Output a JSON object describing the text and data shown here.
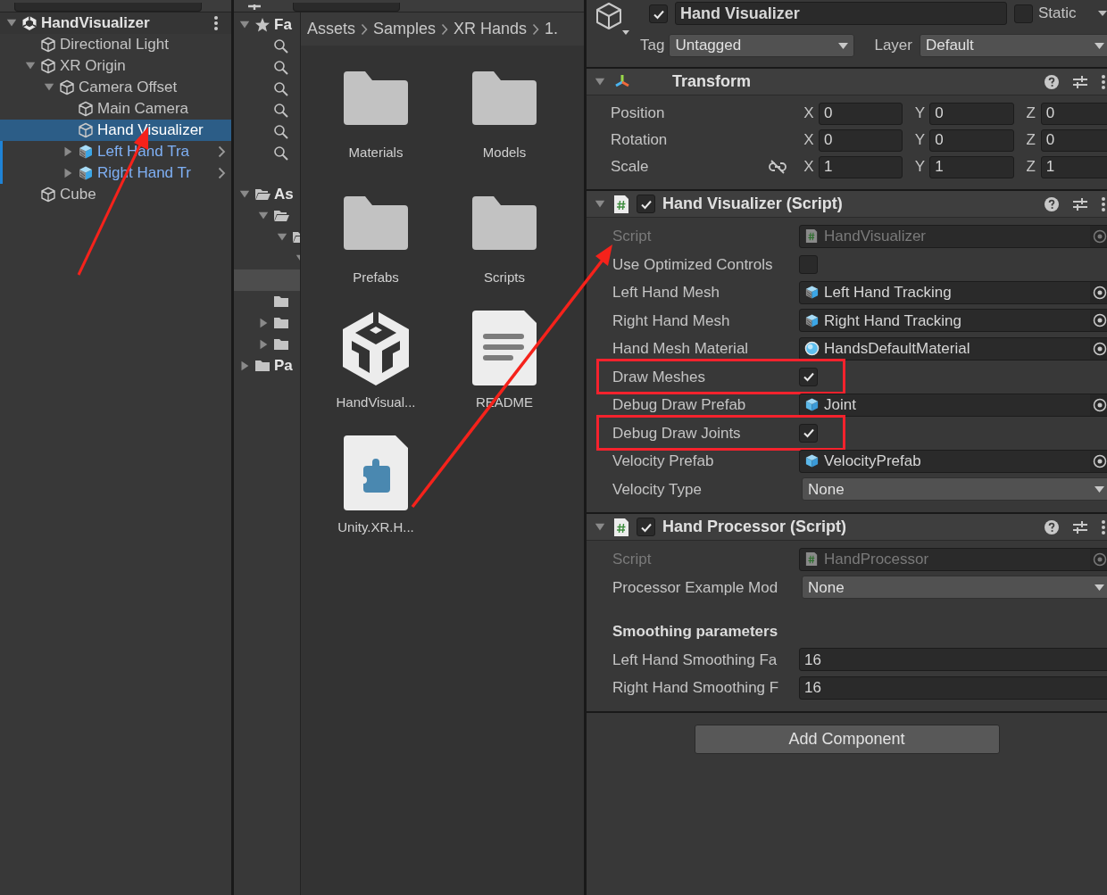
{
  "hierarchy": {
    "scene": {
      "label": "HandVisualizer",
      "kind": "scene",
      "expanded": true,
      "children": [
        {
          "label": "Directional Light",
          "kind": "gameobject",
          "selected": false
        },
        {
          "label": "XR Origin",
          "kind": "gameobject",
          "expanded": true,
          "selected": false,
          "children": [
            {
              "label": "Camera Offset",
              "kind": "gameobject",
              "expanded": true,
              "selected": false,
              "children": [
                {
                  "label": "Main Camera",
                  "kind": "gameobject",
                  "selected": false
                },
                {
                  "label": "Hand Visualizer",
                  "kind": "gameobject",
                  "selected": true
                },
                {
                  "label": "Left Hand Tra",
                  "kind": "prefab",
                  "expanded": false,
                  "selected": false
                },
                {
                  "label": "Right Hand Tr",
                  "kind": "prefab",
                  "expanded": false,
                  "selected": false
                }
              ]
            }
          ]
        },
        {
          "label": "Cube",
          "kind": "gameobject",
          "selected": false
        }
      ]
    }
  },
  "project": {
    "tree": [
      {
        "label": "Fa",
        "kind": "favorites",
        "expanded": true,
        "selected": false,
        "children": [
          {
            "kind": "search",
            "selected": false
          },
          {
            "kind": "search",
            "selected": false
          },
          {
            "kind": "search",
            "selected": false
          },
          {
            "kind": "search",
            "selected": false
          },
          {
            "kind": "search",
            "selected": false
          },
          {
            "kind": "search",
            "selected": false
          }
        ]
      },
      {
        "label": "As",
        "kind": "folder-open",
        "expanded": true,
        "selected": false,
        "children": [
          {
            "kind": "folder-open",
            "expanded": true,
            "selected": false,
            "children": [
              {
                "kind": "folder-open",
                "expanded": true,
                "selected": false,
                "children": [
                  {
                    "expanded": true,
                    "selected": false,
                    "children": [
                      {
                        "selected": true
                      }
                    ]
                  }
                ]
              }
            ]
          },
          {
            "kind": "folder",
            "selected": false
          },
          {
            "kind": "folder",
            "expanded": false,
            "selected": false
          },
          {
            "kind": "folder",
            "expanded": false,
            "selected": false
          }
        ]
      },
      {
        "label": "Pa",
        "kind": "folder",
        "expanded": false,
        "selected": false
      }
    ],
    "breadcrumb": [
      "Assets",
      "Samples",
      "XR Hands",
      "1."
    ],
    "assets": [
      {
        "label": "Materials",
        "kind": "folder"
      },
      {
        "label": "Models",
        "kind": "folder"
      },
      {
        "label": "Prefabs",
        "kind": "folder"
      },
      {
        "label": "Scripts",
        "kind": "folder"
      },
      {
        "label": "HandVisual...",
        "kind": "unity"
      },
      {
        "label": "README",
        "kind": "document"
      },
      {
        "label": "Unity.XR.H...",
        "kind": "package"
      }
    ]
  },
  "inspector": {
    "active": true,
    "name": "Hand Visualizer",
    "static": false,
    "static_label": "Static",
    "tag_label": "Tag",
    "tag": "Untagged",
    "layer_label": "Layer",
    "layer": "Default",
    "components": [
      {
        "kind": "transform",
        "title": "Transform",
        "expanded": true,
        "rows": [
          {
            "label": "Position",
            "values": [
              {
                "axis": "X",
                "value": "0"
              },
              {
                "axis": "Y",
                "value": "0"
              },
              {
                "axis": "Z",
                "value": "0"
              }
            ]
          },
          {
            "label": "Rotation",
            "values": [
              {
                "axis": "X",
                "value": "0"
              },
              {
                "axis": "Y",
                "value": "0"
              },
              {
                "axis": "Z",
                "value": "0"
              }
            ]
          },
          {
            "label": "Scale",
            "constrained": false,
            "values": [
              {
                "axis": "X",
                "value": "1"
              },
              {
                "axis": "Y",
                "value": "1"
              },
              {
                "axis": "Z",
                "value": "1"
              }
            ]
          }
        ]
      },
      {
        "kind": "script",
        "title": "Hand Visualizer (Script)",
        "enabled": true,
        "expanded": true,
        "properties": [
          {
            "kind": "script_ref",
            "label": "Script",
            "value": "HandVisualizer",
            "disabled": true
          },
          {
            "kind": "checkbox",
            "label": "Use Optimized Controls",
            "checked": false
          },
          {
            "kind": "model_ref",
            "label": "Left Hand Mesh",
            "value": "Left Hand Tracking"
          },
          {
            "kind": "model_ref",
            "label": "Right Hand Mesh",
            "value": "Right Hand Tracking"
          },
          {
            "kind": "material_ref",
            "label": "Hand Mesh Material",
            "value": "HandsDefaultMaterial"
          },
          {
            "kind": "checkbox",
            "label": "Draw Meshes",
            "checked": true,
            "highlighted": true
          },
          {
            "kind": "prefab_ref",
            "label": "Debug Draw Prefab",
            "value": "Joint"
          },
          {
            "kind": "checkbox",
            "label": "Debug Draw Joints",
            "checked": true,
            "highlighted": true
          },
          {
            "kind": "prefab_ref",
            "label": "Velocity Prefab",
            "value": "VelocityPrefab"
          },
          {
            "kind": "dropdown",
            "label": "Velocity Type",
            "value": "None"
          }
        ]
      },
      {
        "kind": "script",
        "title": "Hand Processor (Script)",
        "enabled": true,
        "expanded": true,
        "properties": [
          {
            "kind": "script_ref",
            "label": "Script",
            "value": "HandProcessor",
            "disabled": true
          },
          {
            "kind": "dropdown",
            "label": "Processor Example Mod",
            "value": "None"
          },
          {
            "kind": "heading",
            "label": "Smoothing parameters"
          },
          {
            "kind": "number",
            "label": "Left Hand Smoothing Fa",
            "value": "16"
          },
          {
            "kind": "number",
            "label": "Right Hand Smoothing F",
            "value": "16"
          }
        ]
      }
    ],
    "add_component": "Add Component"
  },
  "annotation_arrows": true
}
